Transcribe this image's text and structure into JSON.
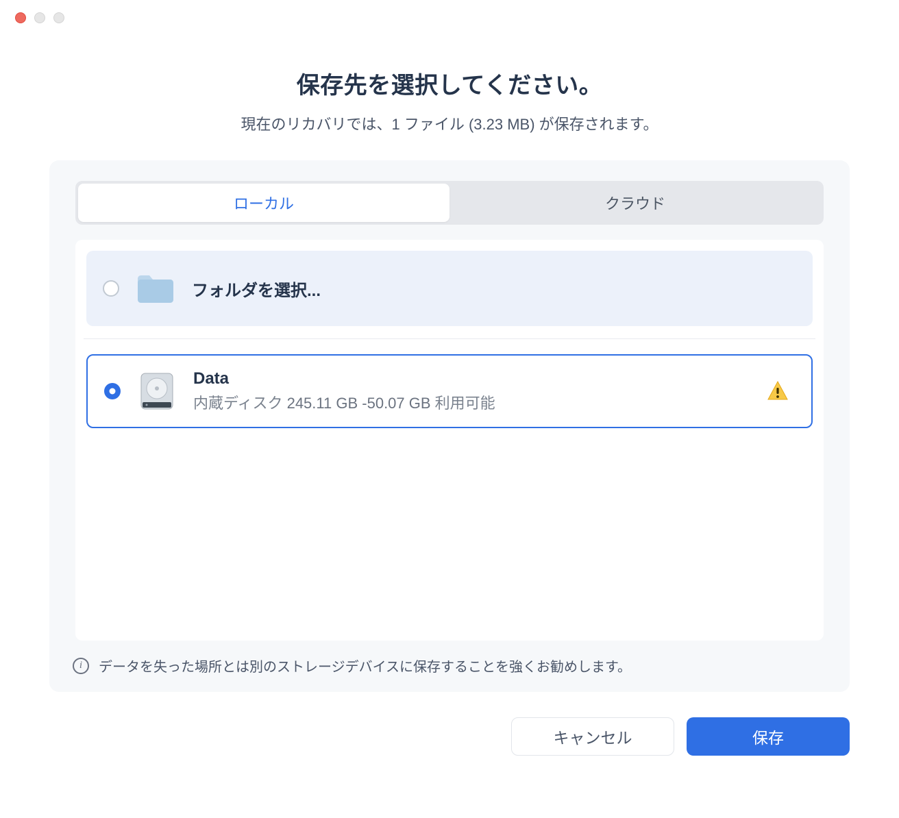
{
  "header": {
    "title": "保存先を選択してください。",
    "subtitle": "現在のリカバリでは、1 ファイル (3.23 MB) が保存されます。"
  },
  "tabs": {
    "local": "ローカル",
    "cloud": "クラウド"
  },
  "options": {
    "folder": {
      "label": "フォルダを選択..."
    },
    "disk": {
      "name": "Data",
      "detail_prefix": "内蔵ディスク ",
      "size": "245.11 GB",
      "sep": " -",
      "free": "50.07 GB",
      "avail_suffix": " 利用可能"
    }
  },
  "tip": "データを失った場所とは別のストレージデバイスに保存することを強くお勧めします。",
  "actions": {
    "cancel": "キャンセル",
    "save": "保存"
  }
}
